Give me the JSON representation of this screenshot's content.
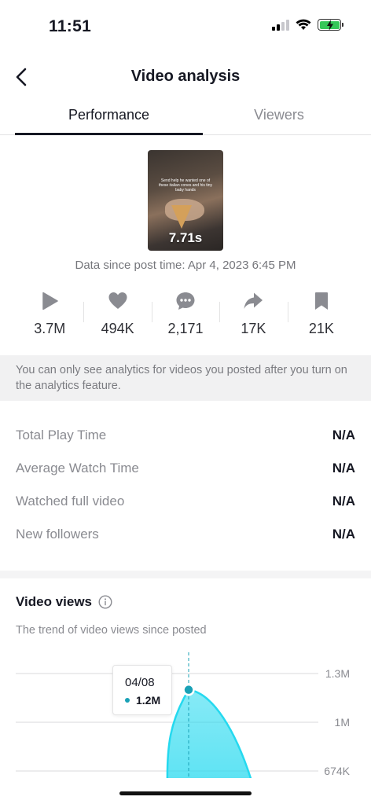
{
  "status_bar": {
    "time": "11:51"
  },
  "header": {
    "title": "Video analysis"
  },
  "tabs": [
    {
      "label": "Performance",
      "active": true
    },
    {
      "label": "Viewers",
      "active": false
    }
  ],
  "video": {
    "caption": "Send help he wanted one of these italian cones and his tiny baby hands",
    "duration": "7.71s"
  },
  "data_since": "Data since post time: Apr 4, 2023 6:45 PM",
  "stats": [
    {
      "icon": "play-icon",
      "value": "3.7M"
    },
    {
      "icon": "heart-icon",
      "value": "494K"
    },
    {
      "icon": "comment-icon",
      "value": "2,171"
    },
    {
      "icon": "share-icon",
      "value": "17K"
    },
    {
      "icon": "bookmark-icon",
      "value": "21K"
    }
  ],
  "notice": "You can only see analytics for videos you posted after you turn on the analytics feature.",
  "metrics": [
    {
      "label": "Total Play Time",
      "value": "N/A"
    },
    {
      "label": "Average Watch Time",
      "value": "N/A"
    },
    {
      "label": "Watched full video",
      "value": "N/A"
    },
    {
      "label": "New followers",
      "value": "N/A"
    }
  ],
  "views_section": {
    "title": "Video views",
    "subtitle": "The trend of video views since posted"
  },
  "tooltip": {
    "date": "04/08",
    "value": "1.2M"
  },
  "chart_data": {
    "type": "area",
    "title": "Video views",
    "x": [
      "04/08"
    ],
    "values": [
      1200000
    ],
    "y_ticks": [
      "1.3M",
      "1M",
      "674K"
    ],
    "grid": true,
    "color": "#25d9ef"
  },
  "colors": {
    "accent": "#25d9ef",
    "tooltip_dot": "#19a1b6",
    "battery": "#35c759"
  }
}
